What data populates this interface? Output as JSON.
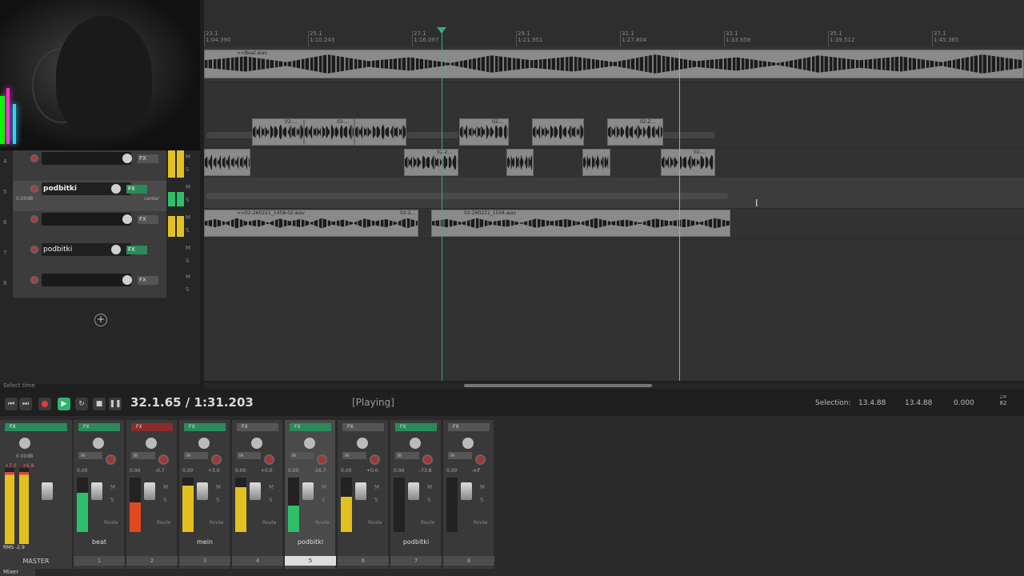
{
  "status_hint": "Select time",
  "ruler": [
    {
      "bar": "23.1",
      "time": "1:04.390"
    },
    {
      "bar": "25.1",
      "time": "1:10.243"
    },
    {
      "bar": "27.1",
      "time": "1:16.097"
    },
    {
      "bar": "29.1",
      "time": "1:21.951"
    },
    {
      "bar": "31.1",
      "time": "1:27.804"
    },
    {
      "bar": "33.1",
      "time": "1:33.658"
    },
    {
      "bar": "35.1",
      "time": "1:39.512"
    },
    {
      "bar": "37.1",
      "time": "1:45.365"
    }
  ],
  "tracks": [
    {
      "num": "4",
      "name": "",
      "fx": "FX"
    },
    {
      "num": "5",
      "name": "podbitki",
      "fx": "FX",
      "vol": "0.00dB",
      "pan": "center"
    },
    {
      "num": "6",
      "name": "",
      "fx": "FX"
    },
    {
      "num": "7",
      "name": "podbitki",
      "fx": "FX"
    },
    {
      "num": "8",
      "name": "",
      "fx": "FX"
    }
  ],
  "items": {
    "beat": "<<Beat.wav",
    "v1": "02-...",
    "v2": "02-...",
    "v3": "02-...",
    "v4": "02-2...",
    "v5": "02-2...",
    "v6": "02-...",
    "l4a": "<<02-260221_1458-02.wav",
    "l4b": "02-2...",
    "l4c": "02-260221_1504.wav"
  },
  "ms": {
    "m": "M",
    "s": "S"
  },
  "transport": {
    "time": "32.1.65 / 1:31.203",
    "state": "[Playing]",
    "selection_label": "Selection:",
    "sel_start": "13.4.88",
    "sel_end": "13.4.88",
    "sel_len": "0.000",
    "tempo_top": "♩=",
    "tempo_val": "82"
  },
  "mixer": {
    "master": {
      "fx": "FX",
      "vol": "0.00dB",
      "peak_l": "+7.0",
      "peak_r": "+6.8",
      "rms": "RMS",
      "rms_val": "-2.9",
      "label": "MASTER"
    },
    "strips": [
      {
        "num": "1",
        "name": "beat",
        "vol_l": "0.00",
        "vol_r": "",
        "meter": 0.72,
        "color": "#2fbf6a",
        "route": "Route",
        "fx": "FX",
        "in": "in"
      },
      {
        "num": "2",
        "name": "",
        "vol_l": "0.00",
        "vol_r": "-0.7",
        "meter": 0.55,
        "color": "#e04a20",
        "route": "Route",
        "fx": "FX",
        "in": "in"
      },
      {
        "num": "3",
        "name": "mein",
        "vol_l": "0.00",
        "vol_r": "+3.0",
        "meter": 0.85,
        "color": "#e2c020",
        "route": "Route",
        "fx": "FX",
        "in": "in"
      },
      {
        "num": "4",
        "name": "",
        "vol_l": "0.00",
        "vol_r": "+0.0",
        "meter": 0.82,
        "color": "#e2c020",
        "route": "Route",
        "fx": "FX",
        "in": "in"
      },
      {
        "num": "5",
        "name": "podbitki",
        "vol_l": "0.00",
        "vol_r": "-16.7",
        "meter": 0.48,
        "color": "#2fbf6a",
        "route": "Route",
        "fx": "FX",
        "in": "in"
      },
      {
        "num": "6",
        "name": "",
        "vol_l": "0.00",
        "vol_r": "+0.0",
        "meter": 0.65,
        "color": "#e2c020",
        "route": "Route",
        "fx": "FX",
        "in": "in"
      },
      {
        "num": "7",
        "name": "podbitki",
        "vol_l": "0.00",
        "vol_r": "-73.8",
        "meter": 0.0,
        "color": "#2fbf6a",
        "route": "Route",
        "fx": "FX",
        "in": "in"
      },
      {
        "num": "8",
        "name": "",
        "vol_l": "0.00",
        "vol_r": "-inf",
        "meter": 0.0,
        "color": "#2fbf6a",
        "route": "Route",
        "fx": "FX",
        "in": "in"
      }
    ]
  },
  "mixer_tab": "Mixer"
}
